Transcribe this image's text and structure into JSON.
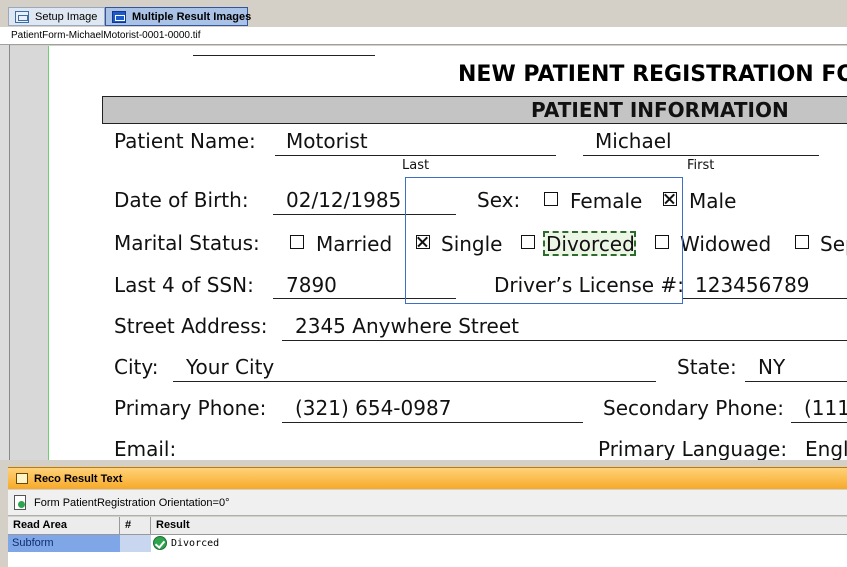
{
  "tabs": [
    {
      "label": "Setup Image",
      "icon": "setup-image-icon"
    },
    {
      "label": "Multiple Result Images",
      "icon": "result-images-icon",
      "selected": true
    }
  ],
  "file_name": "PatientForm-MichaelMotorist-0001-0000.tif",
  "form": {
    "title": "NEW PATIENT REGISTRATION FOF",
    "section": "PATIENT INFORMATION",
    "patient_name_label": "Patient Name:",
    "last_name": "Motorist",
    "first_name": "Michael",
    "last_caption": "Last",
    "first_caption": "First",
    "dob_label": "Date of Birth:",
    "dob": "02/12/1985",
    "sex_label": "Sex:",
    "sex_options": [
      {
        "label": "Female",
        "checked": false
      },
      {
        "label": "Male",
        "checked": true
      }
    ],
    "marital_label": "Marital Status:",
    "marital_options": [
      {
        "label": "Married",
        "checked": false
      },
      {
        "label": "Single",
        "checked": true
      },
      {
        "label": "Divorced",
        "checked": false,
        "highlighted": true
      },
      {
        "label": "Widowed",
        "checked": false
      },
      {
        "label": "Sep",
        "checked": false
      }
    ],
    "ssn_label": "Last 4 of SSN:",
    "ssn": "7890",
    "license_label": "Driver’s License #:",
    "license": "123456789",
    "street_label": "Street Address:",
    "street": "2345 Anywhere Street",
    "city_label": "City:",
    "city": "Your City",
    "state_label": "State:",
    "state": "NY",
    "primary_phone_label": "Primary Phone:",
    "primary_phone": "(321) 654-0987",
    "secondary_phone_label": "Secondary Phone:",
    "secondary_phone": "(111",
    "email_label": "Email:",
    "language_label": "Primary Language:",
    "language": "Engl"
  },
  "reco_panel": {
    "title": "Reco Result Text",
    "form_line": "Form PatientRegistration  Orientation=0°",
    "columns": [
      "Read Area",
      "#",
      "Result"
    ],
    "rows": [
      {
        "read_area": "Subform",
        "num": "",
        "result": "Divorced",
        "status": "ok"
      }
    ]
  },
  "colors": {
    "panel_header": "#f7a928",
    "tab_selected": "#a9c2e6",
    "row_highlight": "#7fa7e8",
    "selection_box": "#3f6fc4"
  }
}
